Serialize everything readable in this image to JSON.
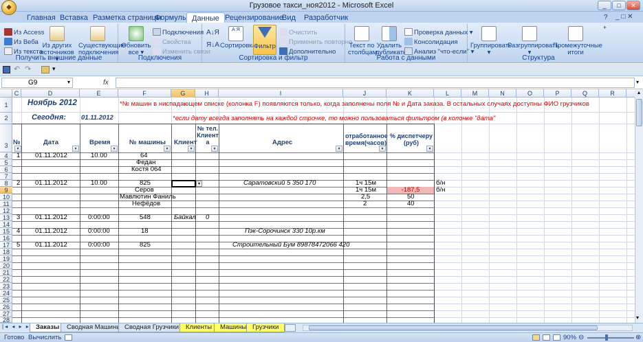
{
  "window": {
    "title": "Грузовое такси_ноя2012 - Microsoft Excel"
  },
  "tabs": [
    "Главная",
    "Вставка",
    "Разметка страницы",
    "Формулы",
    "Данные",
    "Рецензирование",
    "Вид",
    "Разработчик"
  ],
  "ribbon": {
    "groups": {
      "external": "Получить внешние данные",
      "connections": "Подключения",
      "sortfilter": "Сортировка и фильтр",
      "datatools": "Работа с данными",
      "outline": "Структура"
    },
    "from_access": "Из Access",
    "from_web": "Из Веба",
    "from_text": "Из текста",
    "other_sources": "Из других источников",
    "existing_connections": "Существующие подключения",
    "refresh_all": "Обновить все",
    "connections": "Подключения",
    "properties": "Свойства",
    "edit_links": "Изменить связи",
    "sort": "Сортировка",
    "filter": "Фильтр",
    "clear": "Очистить",
    "reapply": "Применить повторно",
    "advanced": "Дополнительно",
    "text_to_columns": "Текст по столбцам",
    "remove_duplicates": "Удалить дубликаты",
    "data_validation": "Проверка данных",
    "consolidate": "Консолидация",
    "what_if": "Анализ \"что-если\"",
    "group": "Группировать",
    "ungroup": "Разгруппировать",
    "subtotal": "Промежуточные итоги"
  },
  "formula_bar": {
    "name_box": "G9",
    "fx": "fx",
    "value": ""
  },
  "columns": [
    "C",
    "D",
    "E",
    "F",
    "G",
    "H",
    "I",
    "J",
    "K",
    "L",
    "M",
    "N",
    "O",
    "P",
    "Q",
    "R"
  ],
  "rows": [
    "1",
    "2",
    "3",
    "4",
    "5",
    "6",
    "7",
    "8",
    "9",
    "10",
    "11",
    "12",
    "13",
    "14",
    "15",
    "16",
    "17",
    "18",
    "19",
    "20",
    "21",
    "22",
    "23",
    "24",
    "25",
    "26",
    "27",
    "28"
  ],
  "sheet": {
    "title": "Ноябрь 2012",
    "note1": "*№ машин в ниспадающем списке (колонка F) появляются только, когда заполнены поля № и Дата  заказа. В остальных случаях доступны ФИО грузчиков",
    "today_label": "Сегодня:",
    "today_value": "01.11.2012",
    "note2": "*если дату всегда заполнять на каждой строчке, то можно пользоваться фильтром (в колонке \"дата\"",
    "headers": {
      "num": "№",
      "date": "Дата",
      "time": "Время",
      "car": "№ машины",
      "client": "Клиент",
      "phone": "№ тел. Клиент а",
      "address": "Адрес",
      "worked": "отработанное время(часов)",
      "disp": "% диспетчеру (руб)"
    },
    "cells": {
      "r5c": "1",
      "r5d": "01.11.2012",
      "r5e": "10.00",
      "r5f": "64",
      "r6f": "Федан",
      "r7f": "Костя 064",
      "r9c": "2",
      "r9d": "01.11.2012",
      "r9e": "10.00",
      "r9f": "825",
      "r9i": "Саратовский 5       350  170",
      "r9j": "1ч 15м",
      "r9l": "б/н",
      "r10f": "Серов",
      "r10j": "1ч 15м",
      "r10k": "-187,5",
      "r10l": "б/н",
      "r11f": "Мавлютин Фаниль",
      "r11j": "2,5",
      "r11k": "50",
      "r12f": "Нефёдов",
      "r12j": "2",
      "r12k": "40",
      "r14c": "3",
      "r14d": "01.11.2012",
      "r14e": "0:00:00",
      "r14f": "548",
      "r14g": "Байкал",
      "r14h": "0",
      "r16c": "4",
      "r16d": "01.11.2012",
      "r16e": "0:00:00",
      "r16f": "18",
      "r16i": "Пэк-Сорочинск  330    10р.км",
      "r18c": "5",
      "r18d": "01.11.2012",
      "r18e": "0:00:00",
      "r18f": "825",
      "r18i": "Строительный Бум  89878472066   420"
    }
  },
  "sheet_tabs": [
    "Заказы",
    "Сводная Машины",
    "Сводная Грузчики",
    "Клиенты",
    "Машины",
    "Грузчики"
  ],
  "status": {
    "ready": "Готово",
    "calculate": "Вычислить",
    "zoom": "90%"
  },
  "colors": {
    "ribbon": "#c6d9f1",
    "accent": "#15428b",
    "negative_bg": "#f2b8b8",
    "tab_yellow": "#ffff66"
  }
}
